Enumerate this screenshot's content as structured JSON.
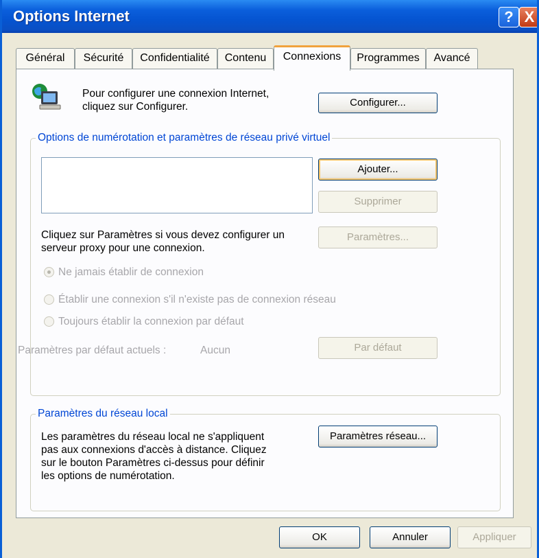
{
  "window": {
    "title": "Options Internet"
  },
  "titlebar": {
    "help": "?",
    "close": "X"
  },
  "tabs": [
    {
      "label": "Général"
    },
    {
      "label": "Sécurité"
    },
    {
      "label": "Confidentialité"
    },
    {
      "label": "Contenu"
    },
    {
      "label": "Connexions"
    },
    {
      "label": "Programmes"
    },
    {
      "label": "Avancé"
    }
  ],
  "setup": {
    "text_line1": "Pour configurer une connexion Internet,",
    "text_line2": "cliquez sur Configurer.",
    "configure_button": "Configurer..."
  },
  "dialup": {
    "legend": "Options de numérotation et paramètres de réseau privé virtuel",
    "add_button": "Ajouter...",
    "remove_button": "Supprimer",
    "proxy_text_line1": "Cliquez sur Paramètres si vous devez configurer un",
    "proxy_text_line2": "serveur proxy pour une connexion.",
    "settings_button": "Paramètres...",
    "radio_options": [
      {
        "label": "Ne jamais établir de connexion",
        "selected": true
      },
      {
        "label": "Établir une connexion s'il n'existe pas de connexion réseau",
        "selected": false
      },
      {
        "label": "Toujours établir la connexion par défaut",
        "selected": false
      }
    ],
    "default_label": "Paramètres par défaut actuels :",
    "default_value": "Aucun",
    "default_button": "Par défaut"
  },
  "lan": {
    "legend": "Paramètres du réseau local",
    "text_lines": [
      "Les paramètres du réseau local ne s'appliquent",
      "pas aux connexions d'accès à distance. Cliquez",
      "sur le bouton Paramètres ci-dessus pour définir",
      "les options de numérotation."
    ],
    "lan_settings_button": "Paramètres réseau..."
  },
  "footer": {
    "ok_button": "OK",
    "cancel_button": "Annuler",
    "apply_button": "Appliquer"
  }
}
